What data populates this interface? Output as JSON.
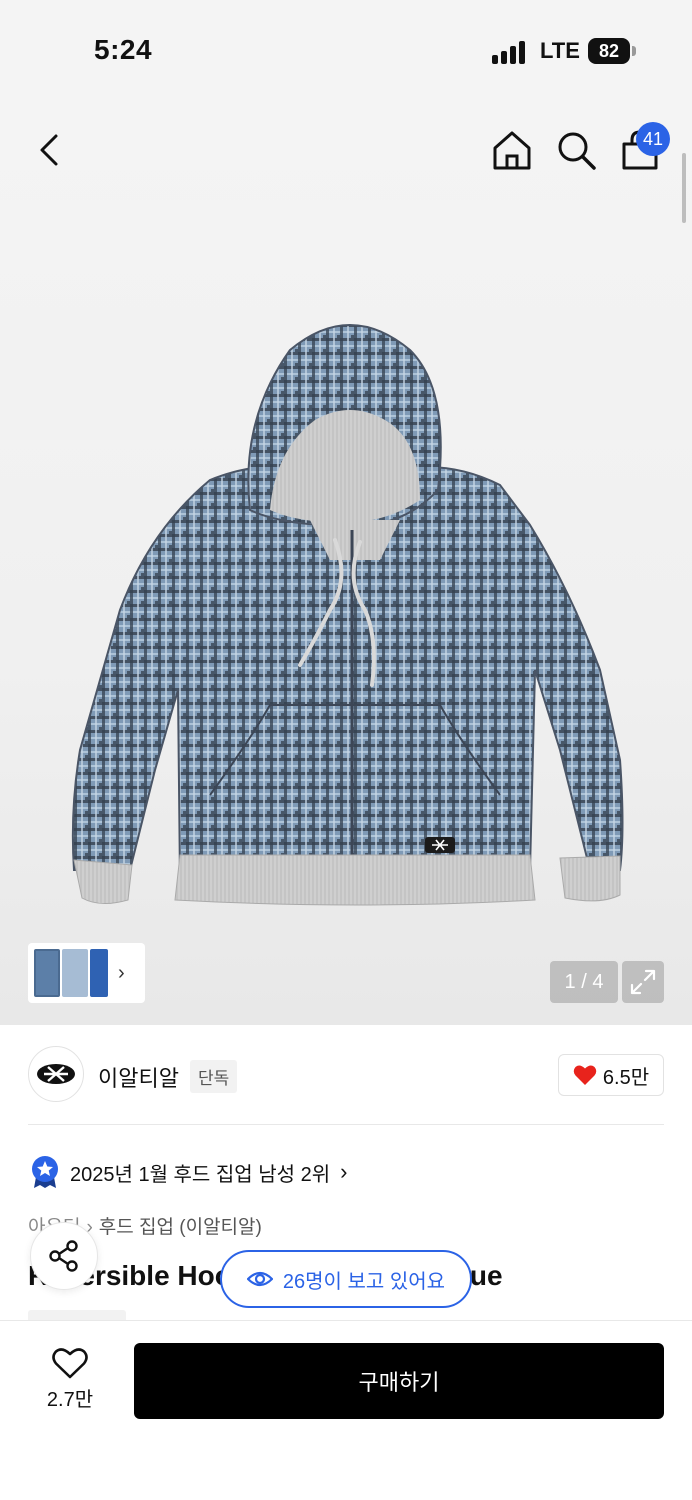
{
  "status_bar": {
    "time": "5:24",
    "network": "LTE",
    "battery": "82"
  },
  "header": {
    "cart_count": "41"
  },
  "gallery": {
    "counter": "1 / 4"
  },
  "brand": {
    "name": "이알티알",
    "tag": "단독",
    "likes": "6.5만"
  },
  "ranking": {
    "text": "2025년 1월 후드 집업 남성 2위"
  },
  "breadcrumb": {
    "category": "아우터",
    "subcategory": "후드 집업 (이알티알)"
  },
  "product": {
    "title": "Reversible Hood Zip-up Check Blue"
  },
  "viewers": {
    "text": "26명이 보고 있어요"
  },
  "bottom": {
    "wish_count": "2.7만",
    "buy_label": "구매하기"
  },
  "colors": {
    "accent": "#2b63e6",
    "heart": "#e8231c",
    "primary_button": "#000000"
  }
}
